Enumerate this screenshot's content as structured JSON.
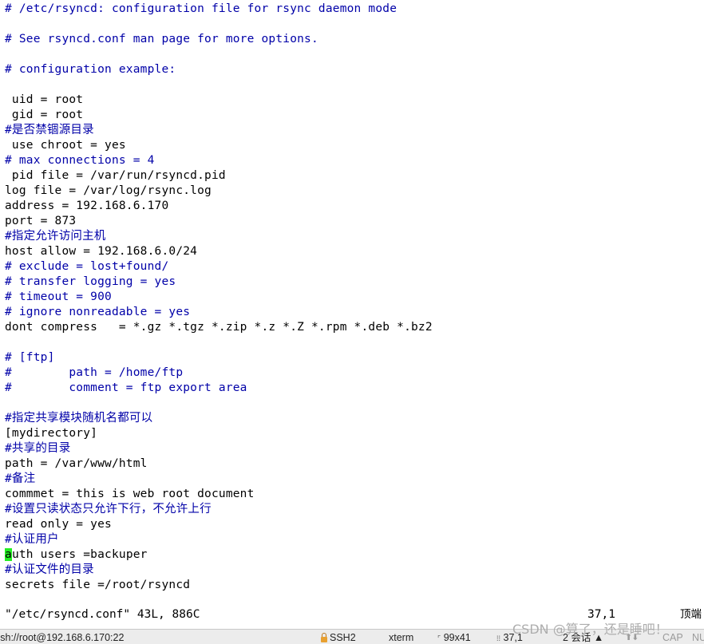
{
  "editor": {
    "lines": [
      {
        "text": "# /etc/rsyncd: configuration file for rsync daemon mode",
        "comment": true
      },
      {
        "text": "",
        "comment": false
      },
      {
        "text": "# See rsyncd.conf man page for more options.",
        "comment": true
      },
      {
        "text": "",
        "comment": false
      },
      {
        "text": "# configuration example:",
        "comment": true
      },
      {
        "text": "",
        "comment": false
      },
      {
        "text": " uid = root",
        "comment": false
      },
      {
        "text": " gid = root",
        "comment": false
      },
      {
        "text": "#是否禁锢源目录",
        "comment": true
      },
      {
        "text": " use chroot = yes",
        "comment": false
      },
      {
        "text": "# max connections = 4",
        "comment": true
      },
      {
        "text": " pid file = /var/run/rsyncd.pid",
        "comment": false
      },
      {
        "text": "log file = /var/log/rsync.log",
        "comment": false
      },
      {
        "text": "address = 192.168.6.170",
        "comment": false
      },
      {
        "text": "port = 873",
        "comment": false
      },
      {
        "text": "#指定允许访问主机",
        "comment": true
      },
      {
        "text": "host allow = 192.168.6.0/24",
        "comment": false
      },
      {
        "text": "# exclude = lost+found/",
        "comment": true
      },
      {
        "text": "# transfer logging = yes",
        "comment": true
      },
      {
        "text": "# timeout = 900",
        "comment": true
      },
      {
        "text": "# ignore nonreadable = yes",
        "comment": true
      },
      {
        "text": "dont compress   = *.gz *.tgz *.zip *.z *.Z *.rpm *.deb *.bz2",
        "comment": false
      },
      {
        "text": "",
        "comment": false
      },
      {
        "text": "# [ftp]",
        "comment": true
      },
      {
        "text": "#        path = /home/ftp",
        "comment": true
      },
      {
        "text": "#        comment = ftp export area",
        "comment": true
      },
      {
        "text": "",
        "comment": false
      },
      {
        "text": "#指定共享模块随机名都可以",
        "comment": true
      },
      {
        "text": "[mydirectory]",
        "comment": false
      },
      {
        "text": "#共享的目录",
        "comment": true
      },
      {
        "text": "path = /var/www/html",
        "comment": false
      },
      {
        "text": "#备注",
        "comment": true
      },
      {
        "text": "commmet = this is web root document",
        "comment": false
      },
      {
        "text": "#设置只读状态只允许下行，不允许上行",
        "comment": true
      },
      {
        "text": "read only = yes",
        "comment": false
      },
      {
        "text": "#认证用户",
        "comment": true
      },
      {
        "text": "auth users =backuper",
        "comment": false,
        "cursor": true
      },
      {
        "text": "#认证文件的目录",
        "comment": true
      },
      {
        "text": "secrets file =/root/rsyncd",
        "comment": false
      }
    ],
    "cursor_line": 37,
    "cursor_col": 1
  },
  "status": {
    "file_info": "\"/etc/rsyncd.conf\" 43L, 886C",
    "position": "37,1",
    "scroll": "顶端"
  },
  "footer": {
    "host": "ssh://root@192.168.6.170:22",
    "protocol": "SSH2",
    "terminal_type": "xterm",
    "size": "99x41",
    "cursor_pos": "37,1",
    "sessions": "2 会话",
    "caps": "CAP",
    "num": "NUM"
  },
  "watermark": "CSDN @算了，还是睡吧！",
  "colors": {
    "comment": "#0000a8",
    "cursor": "#22ee22",
    "text": "#000000",
    "footer_bg": "#ececec"
  }
}
